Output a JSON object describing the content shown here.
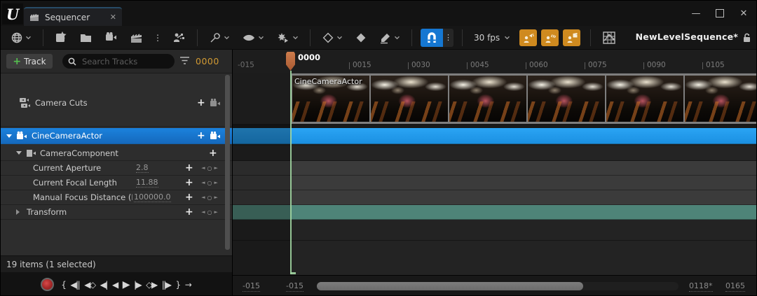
{
  "titlebar": {
    "logo_letter": "U",
    "tab_label": "Sequencer",
    "tab_close_glyph": "✕",
    "minimize_glyph": "—",
    "close_glyph": "✕"
  },
  "toolbar": {
    "fps_label": "30 fps",
    "sequence_name": "NewLevelSequence*",
    "more_dots_glyph": "⋮",
    "snap_dots_glyph": "⋮"
  },
  "outliner": {
    "add_track_plus": "+",
    "add_track_label": "Track",
    "search_placeholder": "Search Tracks",
    "time_display": "0000",
    "plus_glyph": "+",
    "key_prev_glyph": "◄",
    "key_set_glyph": "○",
    "key_next_glyph": "►",
    "tracks": [
      {
        "label": "Camera Cuts"
      },
      {
        "label": "CineCameraActor"
      },
      {
        "label": "CameraComponent"
      },
      {
        "label": "Current Aperture",
        "value": "2.8"
      },
      {
        "label": "Current Focal Length",
        "value": "11.88"
      },
      {
        "label": "Manual Focus Distance (Focu",
        "value": "100000.0"
      },
      {
        "label": "Transform"
      }
    ],
    "status": "19 items (1 selected)"
  },
  "timeline": {
    "ruler_start": "-015",
    "ticks": [
      "0015",
      "0030",
      "0045",
      "0060",
      "0075",
      "0090",
      "0105"
    ],
    "playhead_label": "0000",
    "clip_label": "CineCameraActor"
  },
  "transport": {
    "glyphs": [
      "{",
      "◀||",
      "◀◇",
      "◀|",
      "◀",
      "▶",
      "|▶",
      "◇▶",
      "||▶",
      "}",
      "→"
    ]
  },
  "bottom_bar": {
    "working_start": "-015",
    "view_start": "-015",
    "view_end": "0118*",
    "working_end": "0165"
  },
  "colors": {
    "accent_blue": "#1e9bf0",
    "selection_blue": "#1673c8",
    "snap_blue": "#1577d2",
    "orange_text": "#d29a33",
    "button_orange": "#cf8a1f",
    "teal_track": "#4e8478",
    "playhead_orange": "#c0703f",
    "range_green": "#9fd69f"
  }
}
